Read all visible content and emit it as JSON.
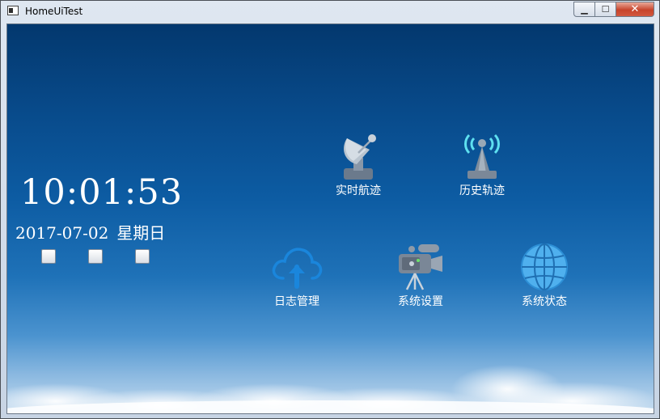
{
  "window": {
    "title": "HomeUiTest",
    "controls": {
      "minimize": "▁",
      "maximize": "☐",
      "close": "✕"
    }
  },
  "clock": {
    "time": "10:01:53",
    "date": "2017-07-02",
    "weekday": "星期日"
  },
  "checkboxes": [
    {
      "checked": false
    },
    {
      "checked": false
    },
    {
      "checked": false
    }
  ],
  "tiles": [
    {
      "label": "实时航迹",
      "icon": "satellite-dish-icon"
    },
    {
      "label": "历史轨迹",
      "icon": "radio-tower-icon"
    },
    {
      "label": "日志管理",
      "icon": "cloud-upload-icon"
    },
    {
      "label": "系统设置",
      "icon": "video-camera-icon"
    },
    {
      "label": "系统状态",
      "icon": "globe-icon"
    }
  ],
  "colors": {
    "sky_top": "#03386e",
    "sky_bottom": "#c5dcf0",
    "cloud_icon": "#1a86dc",
    "globe": "#4fb0ee",
    "tower_signal": "#5ee0f0"
  }
}
